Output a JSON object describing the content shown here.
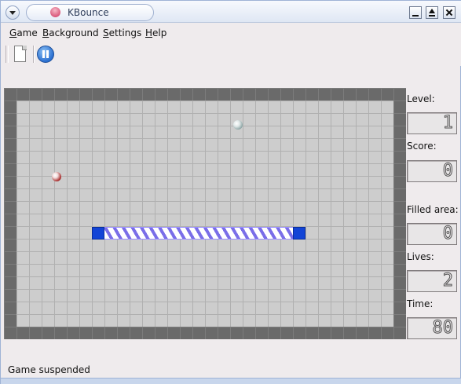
{
  "window": {
    "title": "KBounce",
    "icon": "kbounce-app-icon",
    "buttons": [
      "window-menu-icon",
      "minimize-icon",
      "maximize-icon",
      "close-icon"
    ]
  },
  "menubar": {
    "items": [
      {
        "label": "Game",
        "mnemonic": "G"
      },
      {
        "label": "Background",
        "mnemonic": "B"
      },
      {
        "label": "Settings",
        "mnemonic": "S"
      },
      {
        "label": "Help",
        "mnemonic": "H"
      }
    ]
  },
  "toolbar": {
    "new_game_icon": "new-document-icon",
    "pause_icon": "pause-icon"
  },
  "game": {
    "balls": [
      {
        "name": "ball-1",
        "color": "#dfe7e7"
      },
      {
        "name": "ball-2",
        "color": "#a01a1a"
      }
    ],
    "wall_colors": {
      "cap": "#1244d6",
      "stripe": "#7a6ee8"
    }
  },
  "panel": {
    "level_label": "Level:",
    "level_value": "1",
    "score_label": "Score:",
    "score_value": "0",
    "filled_label": "Filled area:",
    "filled_value": "0",
    "lives_label": "Lives:",
    "lives_value": "2",
    "time_label": "Time:",
    "time_value": "80"
  },
  "statusbar": {
    "text": "Game suspended"
  }
}
